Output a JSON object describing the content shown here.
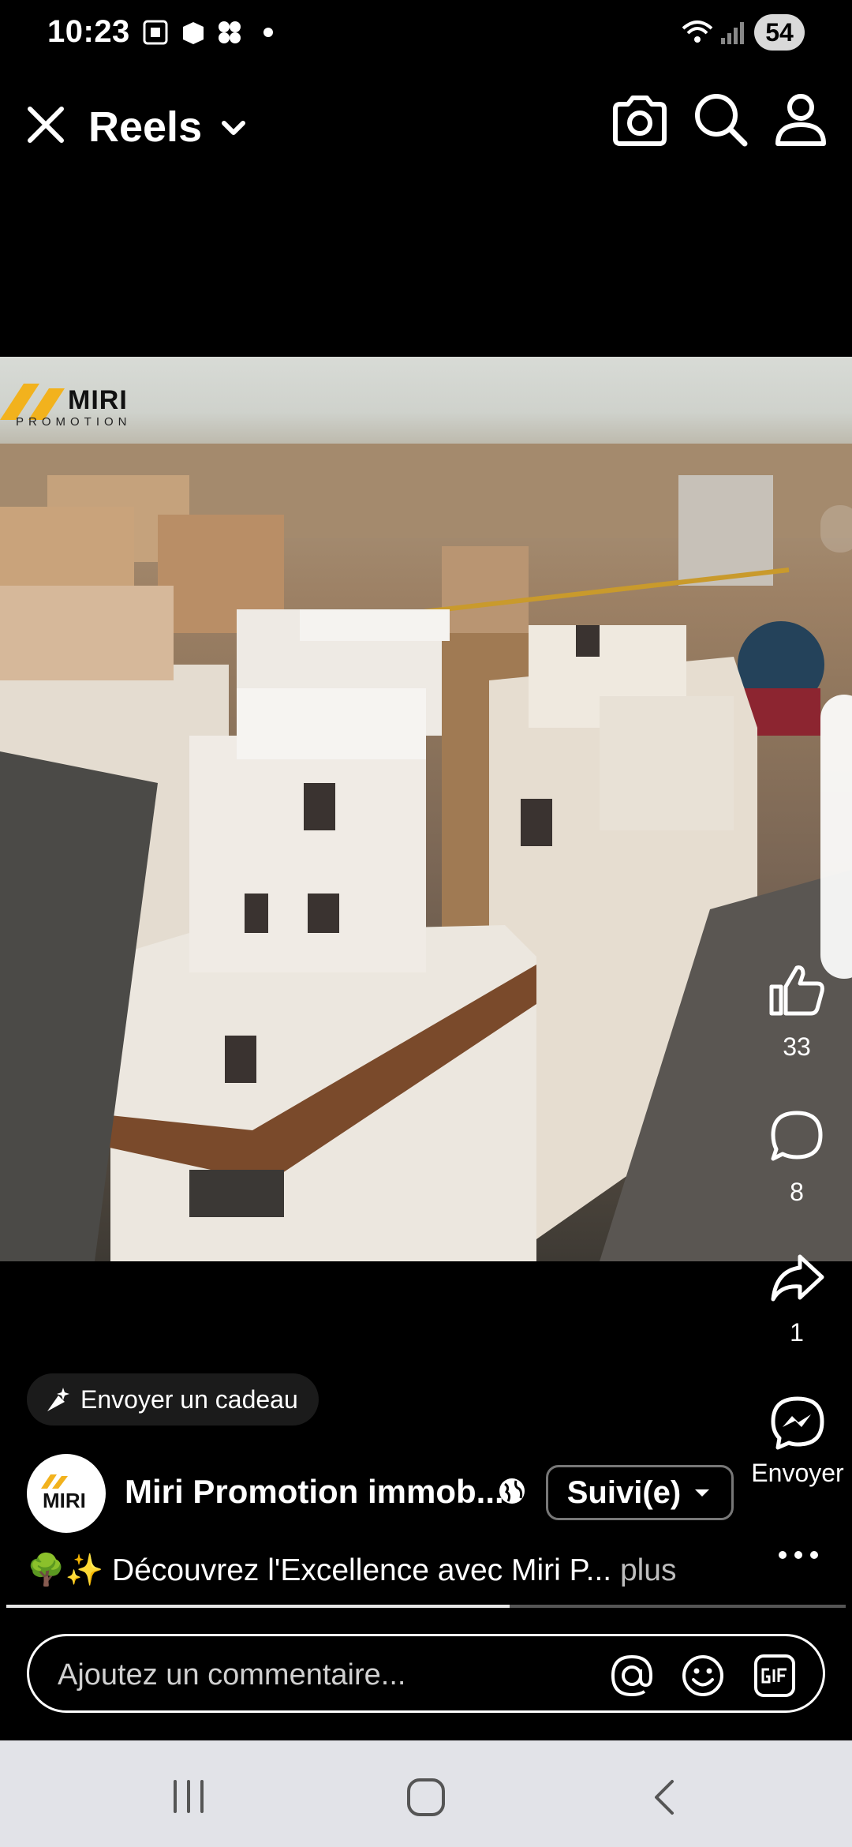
{
  "status_bar": {
    "time": "10:23",
    "battery": "54"
  },
  "top_bar": {
    "title": "Reels"
  },
  "video": {
    "brand_logo": "MIRI",
    "brand_logo_sub": "PROMOTION"
  },
  "actions": {
    "like_count": "33",
    "comment_count": "8",
    "share_count": "1",
    "send_label": "Envoyer"
  },
  "gift": {
    "label": "Envoyer un cadeau"
  },
  "author": {
    "avatar_text": "MIRI",
    "name": "Miri Promotion immob...",
    "follow_label": "Suivi(e)"
  },
  "caption": {
    "emojis": "🌳✨",
    "text": "Découvrez l'Excellence avec Miri P...",
    "more": "plus"
  },
  "progress": 0.6,
  "comment": {
    "placeholder": "Ajoutez un commentaire..."
  }
}
